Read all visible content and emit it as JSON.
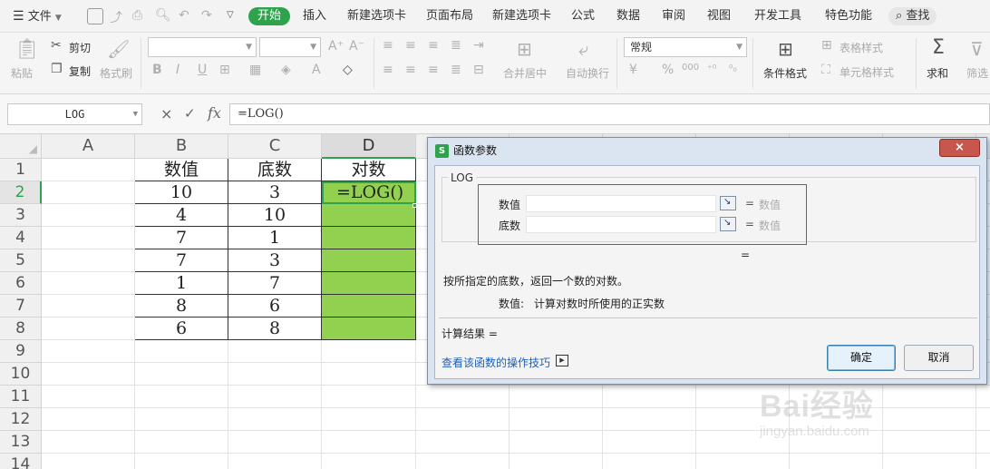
{
  "menu": {
    "file_label": "文件",
    "tabs": [
      "开始",
      "插入",
      "新建选项卡",
      "页面布局",
      "新建选项卡",
      "公式",
      "数据",
      "审阅",
      "视图",
      "开发工具",
      "特色功能"
    ],
    "search_label": "查找"
  },
  "ribbon": {
    "paste": "粘贴",
    "cut": "剪切",
    "copy": "复制",
    "format_painter": "格式刷",
    "font_size_up": "A⁺",
    "font_size_down": "A⁻",
    "bold": "B",
    "italic": "I",
    "underline": "U",
    "merge_center": "合并居中",
    "wrap_text": "自动换行",
    "number_format": "常规",
    "currency": "¥",
    "percent": "%",
    "thousands": "000",
    "cond_format": "条件格式",
    "table_style": "表格样式",
    "cell_style": "单元格样式",
    "sum": "求和",
    "filter": "筛选"
  },
  "formula_bar": {
    "name_box": "LOG",
    "cancel": "×",
    "confirm": "✓",
    "fx": "fx",
    "formula": "=LOG()"
  },
  "sheet": {
    "columns": [
      "A",
      "B",
      "C",
      "D"
    ],
    "rows": [
      "1",
      "2",
      "3",
      "4",
      "5",
      "6",
      "7",
      "8",
      "9",
      "10",
      "11",
      "12",
      "13",
      "14"
    ],
    "headers": [
      "数值",
      "底数",
      "对数"
    ],
    "data": [
      [
        "10",
        "3"
      ],
      [
        "4",
        "10"
      ],
      [
        "7",
        "1"
      ],
      [
        "7",
        "3"
      ],
      [
        "1",
        "7"
      ],
      [
        "8",
        "6"
      ],
      [
        "6",
        "8"
      ]
    ],
    "active_cell_text": "=LOG()"
  },
  "dialog": {
    "title": "函数参数",
    "function_name": "LOG",
    "arg1_label": "数值",
    "arg1_hint": "数值",
    "arg2_label": "底数",
    "arg2_hint": "数值",
    "equals": "=",
    "description": "按所指定的底数，返回一个数的对数。",
    "arg_desc_label": "数值:",
    "arg_desc_text": "计算对数时所使用的正实数",
    "result_label": "计算结果 =",
    "help_link": "查看该函数的操作技巧",
    "ok": "确定",
    "cancel": "取消",
    "close": "×"
  },
  "watermark": {
    "line1": "Bai经验",
    "line2": "jingyan.baidu.com"
  },
  "colors": {
    "accent_green": "#2fa24d",
    "cell_green": "#92d050",
    "highlight_red": "#e03030"
  }
}
